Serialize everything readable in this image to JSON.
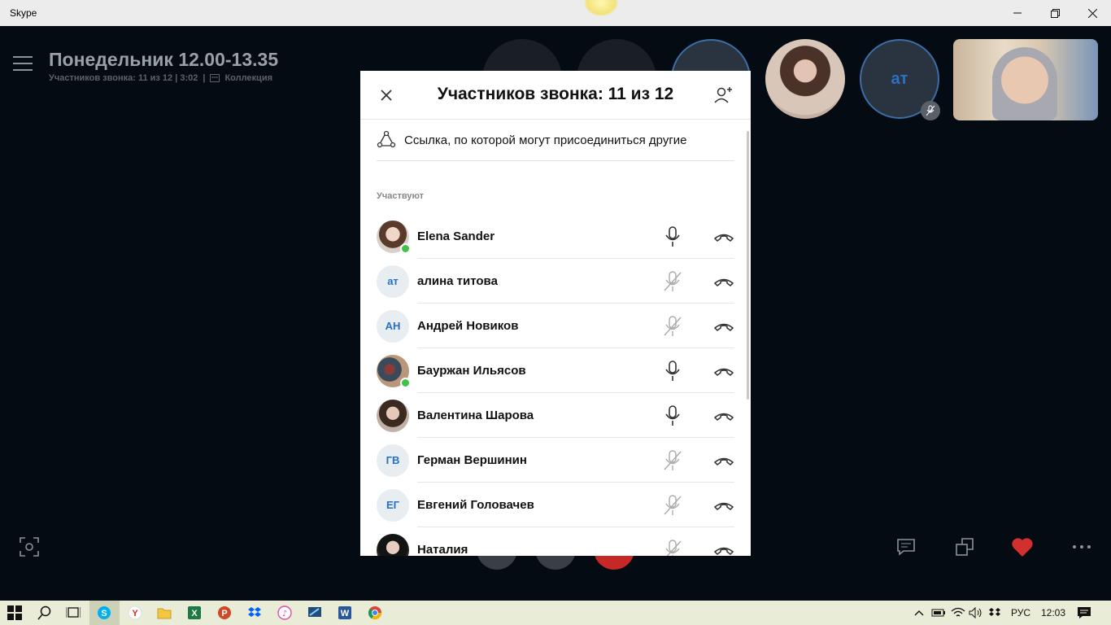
{
  "window": {
    "title": "Skype"
  },
  "call": {
    "title": "Понедельник 12.00-13.35",
    "participants_status": "Участников звонка: 11 из 12 | 3:02",
    "separator": "|",
    "gallery_label": "Коллекция",
    "avatar_initials_tile": "ат"
  },
  "panel": {
    "title": "Участников звонка: 11 из 12",
    "invite_link_label": "Ссылка, по которой могут присоединиться другие",
    "section_label": "Участвуют",
    "participants": [
      {
        "name": "Elena Sander",
        "initials": "",
        "online": true,
        "mic": "on"
      },
      {
        "name": "алина титова",
        "initials": "ат",
        "online": false,
        "mic": "muted"
      },
      {
        "name": "Андрей Новиков",
        "initials": "АН",
        "online": false,
        "mic": "muted"
      },
      {
        "name": "Бауржан Ильясов",
        "initials": "",
        "online": true,
        "mic": "on"
      },
      {
        "name": "Валентина Шарова",
        "initials": "",
        "online": false,
        "mic": "on"
      },
      {
        "name": "Герман Вершинин",
        "initials": "ГВ",
        "online": false,
        "mic": "muted"
      },
      {
        "name": "Евгений Головачев",
        "initials": "ЕГ",
        "online": false,
        "mic": "muted"
      },
      {
        "name": "Наталия",
        "initials": "",
        "online": false,
        "mic": "muted"
      }
    ]
  },
  "taskbar": {
    "language": "РУС",
    "time": "12:03"
  },
  "colors": {
    "stage_bg": "#050b12",
    "accent_blue": "#2670c4",
    "online_green": "#3ec24a",
    "heart_red": "#d32f2f"
  }
}
